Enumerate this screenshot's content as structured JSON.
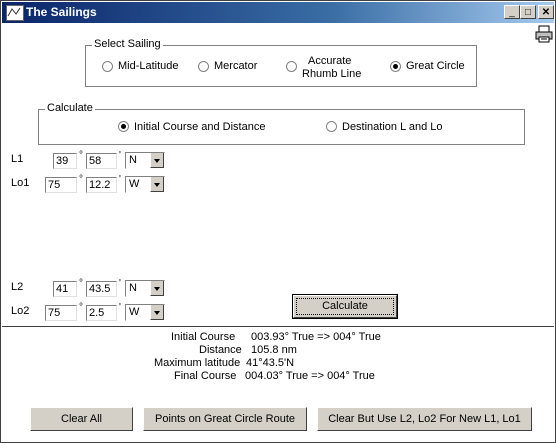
{
  "window": {
    "title": "The Sailings"
  },
  "title_buttons": {
    "minimize": "_",
    "maximize": "□",
    "close": "✕"
  },
  "select_sailing": {
    "legend": "Select Sailing",
    "options": [
      {
        "label": "Mid-Latitude",
        "selected": false
      },
      {
        "label": "Mercator",
        "selected": false
      },
      {
        "label_line1": "Accurate",
        "label_line2": "Rhumb Line",
        "selected": false
      },
      {
        "label": "Great Circle",
        "selected": true
      }
    ]
  },
  "calculate_group": {
    "legend": "Calculate",
    "options": [
      {
        "label": "Initial Course and Distance",
        "selected": true
      },
      {
        "label": "Destination L and Lo",
        "selected": false
      }
    ]
  },
  "l1": {
    "label": "L1",
    "deg": "39",
    "min": "58",
    "hemi": "N"
  },
  "lo1": {
    "label": "Lo1",
    "deg": "75",
    "min": "12.2",
    "hemi": "W"
  },
  "l2": {
    "label": "L2",
    "deg": "41",
    "min": "43.5",
    "hemi": "N"
  },
  "lo2": {
    "label": "Lo2",
    "deg": "75",
    "min": "2.5",
    "hemi": "W"
  },
  "symbols": {
    "degree": "°",
    "minute": "'"
  },
  "calculate_button": "Calculate",
  "results": {
    "initial_course_label": "Initial Course",
    "initial_course_value": "003.93° True => 004° True",
    "distance_label": "Distance",
    "distance_value": "105.8 nm",
    "max_lat_label": "Maximum latitude",
    "max_lat_value": "41°43.5'N",
    "final_course_label": "Final Course",
    "final_course_value": "004.03° True => 004° True"
  },
  "bottom_buttons": {
    "clear_all": "Clear All",
    "points_route": "Points on Great Circle Route",
    "clear_but_use": "Clear But Use L2, Lo2 For New L1, Lo1"
  }
}
